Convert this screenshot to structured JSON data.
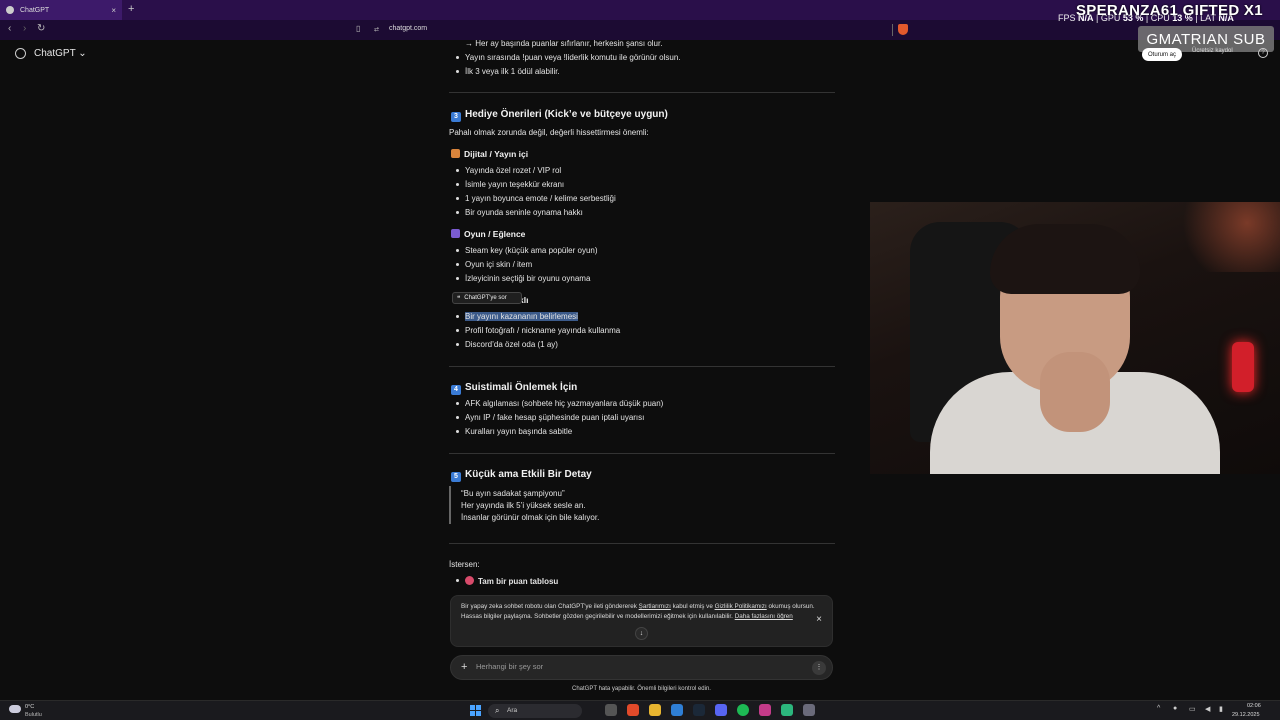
{
  "browser": {
    "tab_title": "ChatGPT",
    "tab_close": "×",
    "new_tab": "+",
    "url": "chatgpt.com"
  },
  "overlay": {
    "fps_label": "FPS",
    "fps_value": "N/A",
    "gpu_label": "GPU",
    "gpu_value": "53 %",
    "cpu_label": "CPU",
    "cpu_value": "13 %",
    "lat_label": "LAT",
    "lat_value": "N/A",
    "title": "SPERANZA61 GIFTED X1",
    "sub_badge": "GMATRIAN SUB"
  },
  "header": {
    "app_title": "ChatGPT",
    "login_label": "Oturum aç",
    "signup_label": "Ücretsiz kaydol"
  },
  "content": {
    "top_lines": [
      "→ Her ay başında puanlar sıfırlanır, herkesin şansı olur.",
      "Yayın sırasında !puan veya !liderlik komutu ile görünür olsun.",
      "İlk 3 veya ilk 1 ödül alabilir."
    ],
    "section3_title": "Hediye Önerileri (Kick’e ve bütçeye uygun)",
    "section3_number": "3",
    "section3_intro": "Pahalı olmak zorunda değil, değerli hissettirmesi önemli:",
    "digital_title": "Dijital / Yayın içi",
    "digital_items": [
      "Yayında özel rozet / VIP rol",
      "İsimle yayın teşekkür ekranı",
      "1 yayın boyunca emote / kelime serbestliği",
      "Bir oyunda seninle oynama hakkı"
    ],
    "game_title": "Oyun / Eğlence",
    "game_items": [
      "Steam key (küçük ama popüler oyun)",
      "Oyun içi skin / item",
      "İzleyicinin seçtiği bir oyunu oynama"
    ],
    "tooltip_text": "ChatGPT'ye sor",
    "hidden_heading_suffix": "klı",
    "special_items": [
      "Bir yayını kazananın belirlemesi",
      "Profil fotoğrafı / nickname yayında kullanma",
      "Discord’da özel oda (1 ay)"
    ],
    "section4_number": "4",
    "section4_title": "Suistimali Önlemek İçin",
    "section4_items": [
      "AFK algılaması (sohbete hiç yazmayanlara düşük puan)",
      "Aynı IP / fake hesap şüphesinde puan iptali uyarısı",
      "Kuralları yayın başında sabitle"
    ],
    "section5_number": "5",
    "section5_title": "Küçük ama Etkili Bir Detay",
    "quote_lines": [
      "“Bu ayın sadakat şampiyonu”",
      "Her yayında ilk 5’i yüksek sesle an.",
      "İnsanlar görünür olmak için bile kalıyor."
    ],
    "outro": "İstersen:",
    "outro_item": "Tam bir puan tablosu"
  },
  "notice": {
    "text1": "Bir yapay zeka sohbet robotu olan ChatGPT'ye ileti göndererek",
    "link_terms": "Şartlarımızı",
    "text2": "kabul etmiş ve",
    "link_privacy": "Gizlilik Politikamızı",
    "text3": "okumuş olursun.",
    "text4": "Hassas bilgiler paylaşma. Sohbetler gözden geçirilebilir ve modellerimizi eğitmek için kullanılabilir.",
    "link_more": "Daha fazlasını öğren",
    "close": "×"
  },
  "composer": {
    "placeholder": "Herhangi bir şey sor"
  },
  "disclaimer": "ChatGPT hata yapabilir. Önemli bilgileri kontrol edin.",
  "taskbar": {
    "weather_temp": "0°C",
    "weather_desc": "Bulutlu",
    "search_label": "Ara",
    "clock_time": "02:06",
    "clock_date": "29.12.2025"
  },
  "colors": {
    "tab_strip": "#2a0f4a",
    "accent_badge": "#3a7bd5",
    "highlight": "#3b5a8a"
  }
}
